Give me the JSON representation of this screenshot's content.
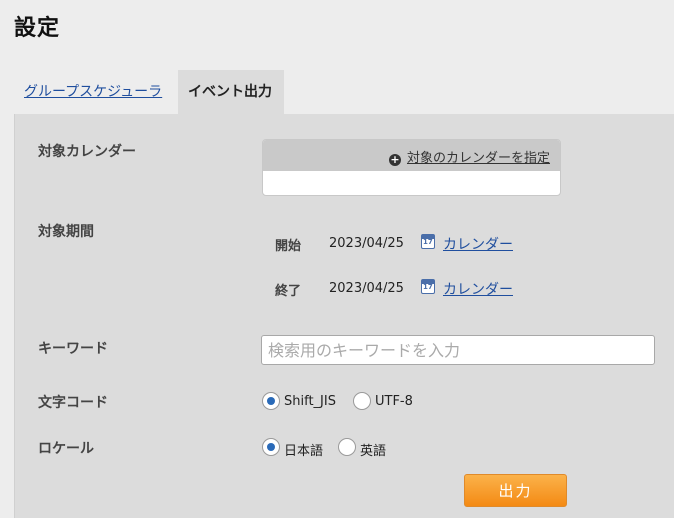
{
  "page": {
    "title": "設定"
  },
  "tabs": [
    {
      "label": "グループスケジューラ",
      "active": false
    },
    {
      "label": "イベント出力",
      "active": true
    }
  ],
  "form": {
    "target_calendar": {
      "label": "対象カレンダー",
      "add_link": "対象のカレンダーを指定"
    },
    "target_period": {
      "label": "対象期間",
      "start_label": "開始",
      "start_date": "2023/04/25",
      "end_label": "終了",
      "end_date": "2023/04/25",
      "calendar_link": "カレンダー"
    },
    "keyword": {
      "label": "キーワード",
      "placeholder": "検索用のキーワードを入力",
      "value": ""
    },
    "charset": {
      "label": "文字コード",
      "options": [
        "Shift_JIS",
        "UTF-8"
      ],
      "selected": "Shift_JIS"
    },
    "locale": {
      "label": "ロケール",
      "options": [
        "日本語",
        "英語"
      ],
      "selected": "日本語"
    },
    "submit_label": "出力"
  },
  "colors": {
    "accent_button": "#f7931e",
    "link": "#1f4e9e",
    "radio_checked": "#2a6ab8"
  },
  "icons": {
    "add": "plus-circle-icon",
    "calendar": "calendar-icon"
  }
}
